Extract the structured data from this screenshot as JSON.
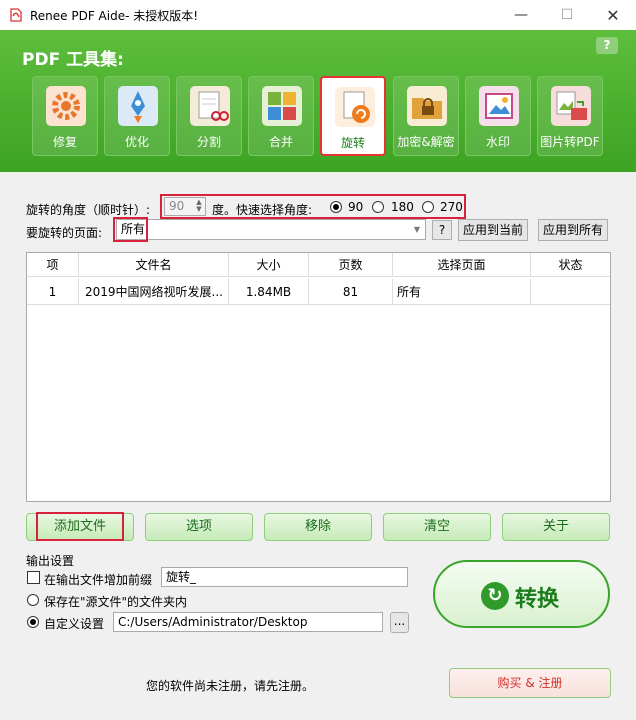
{
  "window": {
    "title": "Renee PDF Aide- 未授权版本!",
    "minimize": "—",
    "maximize": "☐",
    "close": "✕"
  },
  "header": {
    "title": "PDF 工具集:",
    "help": "?",
    "tools": [
      {
        "label": "修复",
        "icon": "repair-gear-icon",
        "color": "#e8772e"
      },
      {
        "label": "优化",
        "icon": "rocket-icon",
        "color": "#3d8ed8"
      },
      {
        "label": "分割",
        "icon": "scissors-icon",
        "color": "#c8a14a"
      },
      {
        "label": "合并",
        "icon": "puzzle-icon",
        "color": "#7bb23e"
      },
      {
        "label": "旋转",
        "icon": "rotate-icon",
        "color": "#f07a1c"
      },
      {
        "label": "加密&解密",
        "icon": "lock-folder-icon",
        "color": "#e0a23a"
      },
      {
        "label": "水印",
        "icon": "watermark-image-icon",
        "color": "#c24c8a"
      },
      {
        "label": "图片转PDF",
        "icon": "image-to-pdf-icon",
        "color": "#d94b4b"
      }
    ],
    "active_tool": "旋转"
  },
  "rotate": {
    "angle_label": "旋转的角度（顺时针）:",
    "angle_value": "90",
    "degree_label": "度。快速选择角度:",
    "options": [
      "90",
      "180",
      "270"
    ],
    "selected_option": "90",
    "pages_label": "要旋转的页面:",
    "pages_value": "所有",
    "help_button": "?",
    "apply_current": "应用到当前",
    "apply_all": "应用到所有"
  },
  "table": {
    "headers": [
      "项",
      "文件名",
      "大小",
      "页数",
      "选择页面",
      "状态"
    ],
    "rows": [
      {
        "index": "1",
        "filename": "2019中国网络视听发展...",
        "size": "1.84MB",
        "pages": "81",
        "selection": "所有",
        "status": ""
      }
    ]
  },
  "actions": {
    "add_file": "添加文件",
    "options": "选项",
    "remove": "移除",
    "clear": "清空",
    "about": "关于"
  },
  "output": {
    "section_label": "输出设置",
    "prefix_label": "在输出文件增加前缀",
    "prefix_value": "旋转_",
    "prefix_checked": false,
    "save_source_label": "保存在\"源文件\"的文件夹内",
    "custom_label": "自定义设置",
    "custom_path": "C:/Users/Administrator/Desktop",
    "browse": "...",
    "selected": "custom"
  },
  "convert": {
    "label": "转换",
    "icon": "refresh-arrow-icon"
  },
  "footer": {
    "register_notice": "您的软件尚未注册，请先注册。",
    "buy_button": "购买 & 注册"
  }
}
